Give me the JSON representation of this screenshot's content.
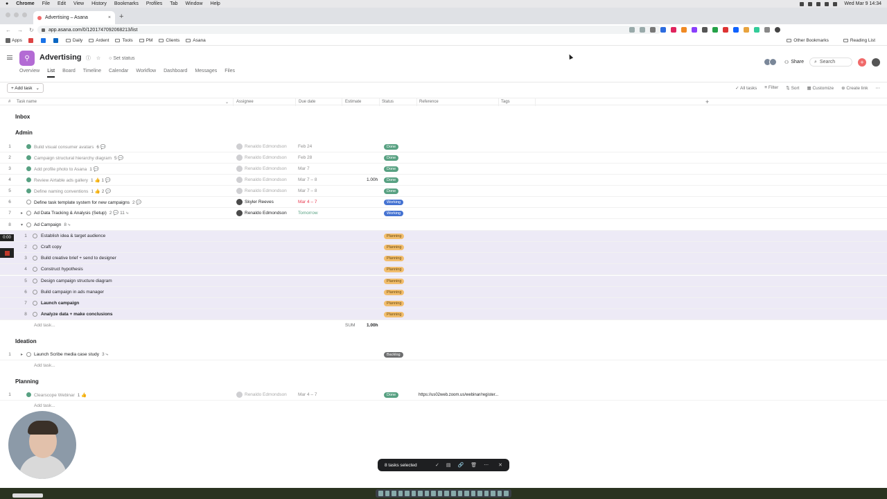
{
  "menubar": {
    "app": "Chrome",
    "items": [
      "File",
      "Edit",
      "View",
      "History",
      "Bookmarks",
      "Profiles",
      "Tab",
      "Window",
      "Help"
    ],
    "clock": "Wed Mar 9  14:34"
  },
  "browser": {
    "tab_title": "Advertising – Asana",
    "url": "app.asana.com/0/1201747092068213/list",
    "bookmarks": [
      "Apps",
      "Daily",
      "Ardent",
      "Tools",
      "PM",
      "Clients",
      "Asana"
    ],
    "other_bookmarks": "Other Bookmarks",
    "reading_list": "Reading List"
  },
  "project": {
    "title": "Advertising",
    "set_status": "Set status",
    "tabs": [
      "Overview",
      "List",
      "Board",
      "Timeline",
      "Calendar",
      "Workflow",
      "Dashboard",
      "Messages",
      "Files"
    ],
    "active_tab": "List",
    "share": "Share",
    "search_placeholder": "Search"
  },
  "toolbar": {
    "add_task": "+ Add task",
    "all_tasks": "All tasks",
    "filter": "Filter",
    "sort": "Sort",
    "customize": "Customize",
    "create_link": "Create link"
  },
  "columns": {
    "num": "#",
    "task": "Task name",
    "assignee": "Assignee",
    "due": "Due date",
    "estimate": "Estimate",
    "status": "Status",
    "reference": "Reference",
    "tags": "Tags"
  },
  "sections": {
    "inbox": "Inbox",
    "admin": "Admin",
    "ideation": "Ideation",
    "planning": "Planning"
  },
  "admin_rows": [
    {
      "n": "1",
      "name": "Build visual consumer avatars",
      "meta": "6 💬",
      "assignee": "Renaldo Edmondson",
      "due": "Feb 24",
      "est": "",
      "status": "Done"
    },
    {
      "n": "2",
      "name": "Campaign structural hierarchy diagram",
      "meta": "5 💬",
      "assignee": "Renaldo Edmondson",
      "due": "Feb 28",
      "est": "",
      "status": "Done"
    },
    {
      "n": "3",
      "name": "Add profile photo to Asana",
      "meta": "1 💬",
      "assignee": "Renaldo Edmondson",
      "due": "Mar 7",
      "est": "",
      "status": "Done"
    },
    {
      "n": "4",
      "name": "Review Airtable ads gallery",
      "meta": "1 👍  1 💬",
      "assignee": "Renaldo Edmondson",
      "due": "Mar 7 – 8",
      "est": "1.00h",
      "status": "Done"
    },
    {
      "n": "5",
      "name": "Define naming conventions",
      "meta": "1 👍  2 💬",
      "assignee": "Renaldo Edmondson",
      "due": "Mar 7 – 8",
      "est": "",
      "status": "Done"
    },
    {
      "n": "6",
      "name": "Define task template system for new campaigns",
      "meta": "2 💬",
      "assignee": "Skyler Reeves",
      "due": "Mar 4 – 7",
      "est": "",
      "status": "Working"
    },
    {
      "n": "7",
      "name": "Ad Data Tracking & Analysis (Setup)",
      "meta": "2 💬  11 ⤷",
      "assignee": "Renaldo Edmondson",
      "due": "Tomorrow",
      "est": "",
      "status": "Working"
    },
    {
      "n": "8",
      "name": "Ad Campaign",
      "meta": "8 ⤷",
      "assignee": "",
      "due": "",
      "est": "",
      "status": ""
    }
  ],
  "subtasks": [
    {
      "n": "1",
      "name": "Establish idea & target audience",
      "status": "Planning"
    },
    {
      "n": "2",
      "name": "Craft copy",
      "status": "Planning"
    },
    {
      "n": "3",
      "name": "Build creative brief + send to designer",
      "status": "Planning"
    },
    {
      "n": "4",
      "name": "Construct hypothesis",
      "status": "Planning"
    },
    {
      "n": "5",
      "name": "Design campaign structure diagram",
      "status": "Planning"
    },
    {
      "n": "6",
      "name": "Build campaign in ads manager",
      "status": "Planning"
    },
    {
      "n": "7",
      "name": "Launch campaign",
      "status": "Planning"
    },
    {
      "n": "8",
      "name": "Analyze data + make conclusions",
      "status": "Planning"
    }
  ],
  "add_task_label": "Add task...",
  "sum_label": "SUM",
  "sum_value": "1.00h",
  "ideation_rows": [
    {
      "n": "1",
      "name": "Launch Scribe media case study",
      "meta": "3 ⤷",
      "status": "Backlog"
    }
  ],
  "planning_rows": [
    {
      "n": "1",
      "name": "Clearscope Webinar",
      "meta": "1 👍",
      "assignee": "Renaldo Edmondson",
      "due": "Mar 4 – 7",
      "status": "Done",
      "reference": "https://us02web.zoom.us/webinar/register..."
    }
  ],
  "recorder": {
    "timer": "0:00"
  },
  "selection_bar": {
    "label": "8 tasks selected"
  }
}
